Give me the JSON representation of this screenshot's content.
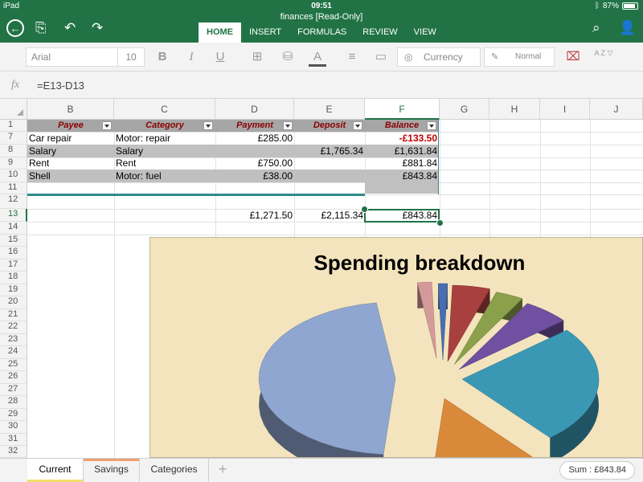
{
  "status_bar": {
    "device": "iPad",
    "time": "09:51",
    "battery": "87%"
  },
  "window": {
    "title": "finances [Read-Only]"
  },
  "ribbon": {
    "tabs": [
      {
        "label": "HOME",
        "active": true
      },
      {
        "label": "INSERT",
        "active": false
      },
      {
        "label": "FORMULAS",
        "active": false
      },
      {
        "label": "REVIEW",
        "active": false
      },
      {
        "label": "VIEW",
        "active": false
      }
    ]
  },
  "toolbar": {
    "font_name": "Arial",
    "font_size": "10",
    "bold": "B",
    "italic": "I",
    "underline": "U",
    "font_color_letter": "A",
    "number_format": "Currency",
    "cell_style": "Normal",
    "sort_label": "A Z"
  },
  "formula_bar": {
    "fx": "fx",
    "formula": "=E13-D13"
  },
  "columns": [
    "B",
    "C",
    "D",
    "E",
    "F",
    "G",
    "H",
    "I",
    "J"
  ],
  "rows": [
    "1",
    "7",
    "8",
    "9",
    "10",
    "11",
    "12",
    "13",
    "14",
    "15",
    "16",
    "17",
    "18",
    "19",
    "20",
    "21",
    "22",
    "23",
    "24",
    "25",
    "26",
    "27",
    "28",
    "29",
    "30",
    "31",
    "32"
  ],
  "table": {
    "headers": [
      "Payee",
      "Category",
      "Payment",
      "Deposit",
      "Balance"
    ],
    "rows": [
      {
        "payee": "Car repair",
        "category": "Motor: repair",
        "payment": "£285.00",
        "deposit": "",
        "balance": "-£133.50"
      },
      {
        "payee": "Salary",
        "category": "Salary",
        "payment": "",
        "deposit": "£1,765.34",
        "balance": "£1,631.84"
      },
      {
        "payee": "Rent",
        "category": "Rent",
        "payment": "£750.00",
        "deposit": "",
        "balance": "£881.84"
      },
      {
        "payee": "Shell",
        "category": "Motor: fuel",
        "payment": "£38.00",
        "deposit": "",
        "balance": "£843.84"
      }
    ],
    "totals": {
      "payment": "£1,271.50",
      "deposit": "£2,115.34",
      "balance": "£843.84"
    }
  },
  "colors": {
    "brand": "#217346",
    "header_text": "#8b0000",
    "negative": "#c00000",
    "chart_bg": "#f4e4bd"
  },
  "chart_data": {
    "type": "pie",
    "title": "Spending breakdown",
    "slices": [
      {
        "color": "#8fa6d0"
      },
      {
        "color": "#d49a9a"
      },
      {
        "color": "#4a6fb0"
      },
      {
        "color": "#a84040"
      },
      {
        "color": "#8aa04a"
      },
      {
        "color": "#7050a0"
      },
      {
        "color": "#3b98b5"
      },
      {
        "color": "#d88a3a"
      }
    ]
  },
  "sheet_tabs": [
    {
      "label": "Current",
      "active": true,
      "color": "#f0e06a"
    },
    {
      "label": "Savings",
      "active": false,
      "color": "#f0a070"
    },
    {
      "label": "Categories",
      "active": false,
      "color": ""
    }
  ],
  "status": {
    "sum": "Sum : £843.84"
  }
}
